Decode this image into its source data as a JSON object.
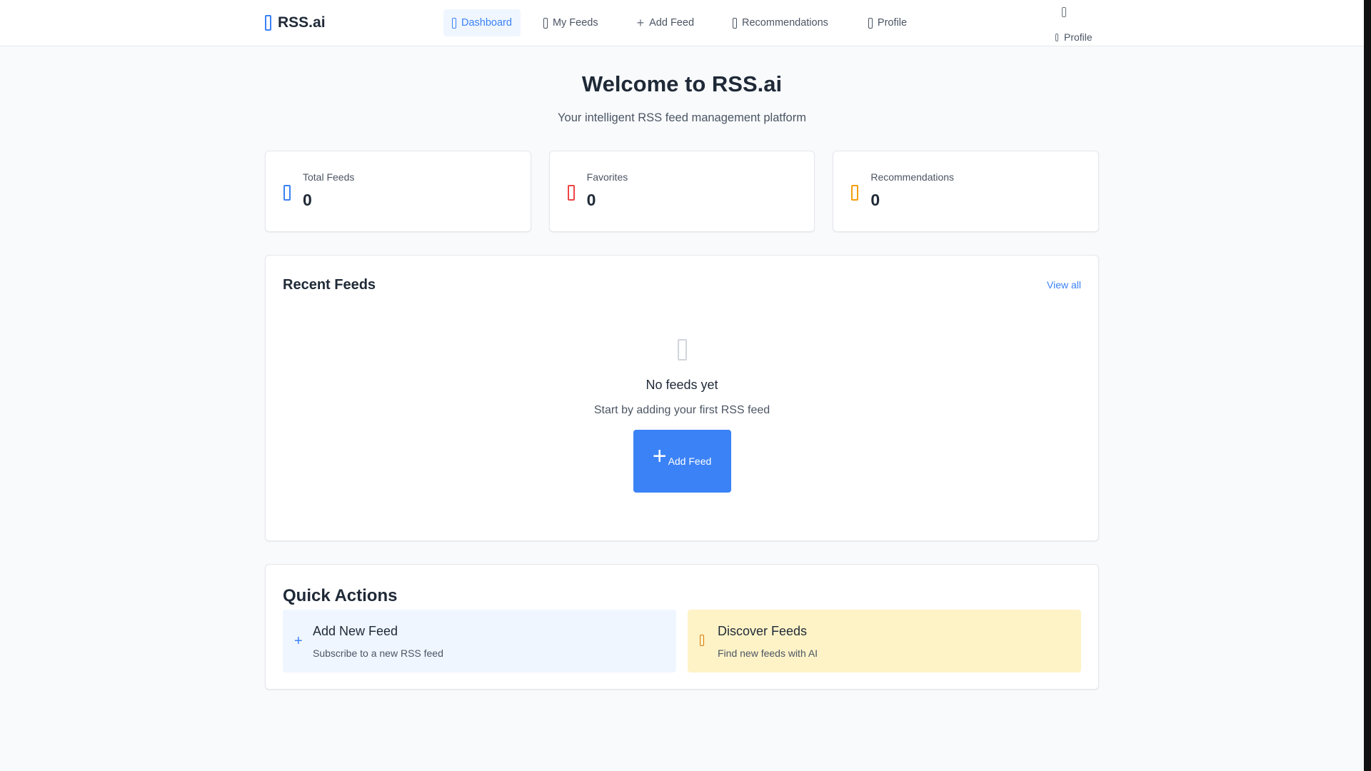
{
  "brand": {
    "name": "RSS.ai",
    "icon": "rss-icon",
    "color": "#3b82f6"
  },
  "nav": {
    "items": [
      {
        "label": "Dashboard",
        "icon": "dashboard-icon",
        "active": true
      },
      {
        "label": "My Feeds",
        "icon": "list-icon"
      },
      {
        "label": "Add Feed",
        "icon": "plus-icon",
        "glyph": "+"
      },
      {
        "label": "Recommendations",
        "icon": "lightbulb-icon"
      },
      {
        "label": "Profile",
        "icon": "user-icon"
      }
    ]
  },
  "user_menu": {
    "bell_icon": "bell-icon",
    "profile_label": "Profile",
    "profile_icon": "user-icon"
  },
  "hero": {
    "title": "Welcome to RSS.ai",
    "subtitle": "Your intelligent RSS feed management platform"
  },
  "stats": [
    {
      "label": "Total Feeds",
      "value": "0",
      "icon": "rss-icon",
      "color": "#3b82f6"
    },
    {
      "label": "Favorites",
      "value": "0",
      "icon": "heart-icon",
      "color": "#ef4444"
    },
    {
      "label": "Recommendations",
      "value": "0",
      "icon": "lightbulb-icon",
      "color": "#f59e0b"
    }
  ],
  "recent": {
    "title": "Recent Feeds",
    "view_all": "View all",
    "empty": {
      "icon": "rss-icon",
      "heading": "No feeds yet",
      "description": "Start by adding your first RSS feed",
      "button_glyph": "+",
      "button_label": "Add Feed"
    }
  },
  "quick_actions": {
    "title": "Quick Actions",
    "items": [
      {
        "title": "Add New Feed",
        "description": "Subscribe to a new RSS feed",
        "icon": "plus-icon",
        "glyph": "+",
        "bg": "#eff6ff"
      },
      {
        "title": "Discover Feeds",
        "description": "Find new feeds with AI",
        "icon": "lightbulb-icon",
        "bg": "#fef3c7"
      }
    ]
  },
  "colors": {
    "accent": "#3b82f6",
    "danger": "#ef4444",
    "warning": "#f59e0b",
    "background": "#f8fafc"
  }
}
